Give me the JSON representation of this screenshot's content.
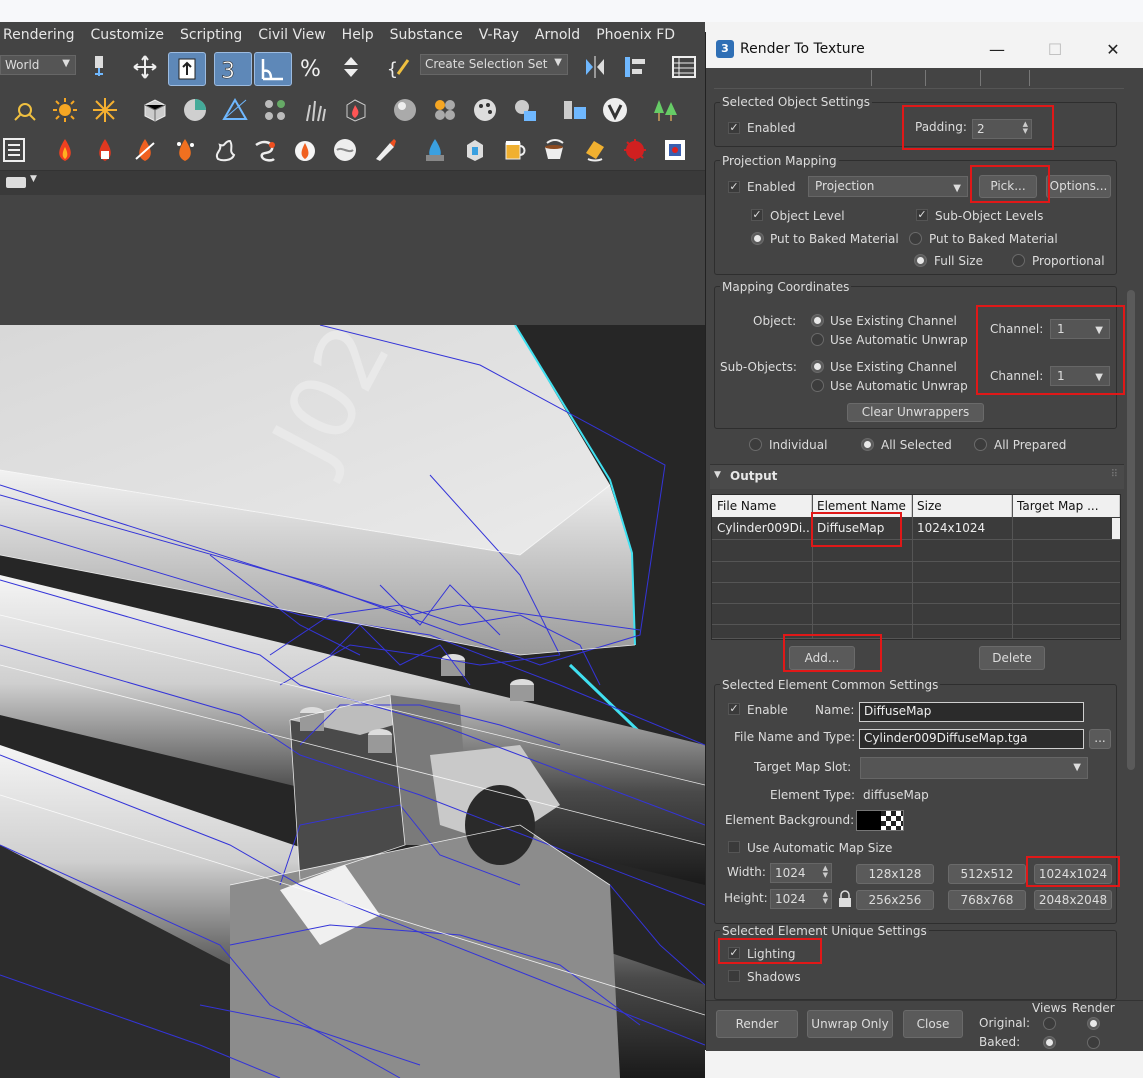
{
  "menu": [
    "Rendering",
    "Customize",
    "Scripting",
    "Civil View",
    "Help",
    "Substance",
    "V-Ray",
    "Arnold",
    "Phoenix FD"
  ],
  "toolbar": {
    "coord_system": "World",
    "selection_set_placeholder": "Create Selection Set"
  },
  "dialog": {
    "title": "Render To Texture",
    "selected_object_settings": {
      "title": "Selected Object Settings",
      "enabled_label": "Enabled",
      "padding_label": "Padding:",
      "padding_value": "2"
    },
    "projection_mapping": {
      "title": "Projection Mapping",
      "enabled_label": "Enabled",
      "projection_value": "Projection",
      "pick_label": "Pick...",
      "options_label": "Options...",
      "object_level": "Object Level",
      "sub_object_levels": "Sub-Object Levels",
      "put_to_baked_1": "Put to Baked Material",
      "put_to_baked_2": "Put to Baked Material",
      "full_size": "Full Size",
      "proportional": "Proportional"
    },
    "mapping_coordinates": {
      "title": "Mapping Coordinates",
      "object_label": "Object:",
      "sub_objects_label": "Sub-Objects:",
      "use_existing_1": "Use Existing Channel",
      "use_auto_1": "Use Automatic Unwrap",
      "use_existing_2": "Use Existing Channel",
      "use_auto_2": "Use Automatic Unwrap",
      "channel_label_1": "Channel:",
      "channel_value_1": "1",
      "channel_label_2": "Channel:",
      "channel_value_2": "1",
      "clear_unwrappers": "Clear Unwrappers"
    },
    "selection_mode": {
      "individual": "Individual",
      "all_selected": "All Selected",
      "all_prepared": "All Prepared"
    },
    "output": {
      "title": "Output",
      "columns": [
        "File Name",
        "Element Name",
        "Size",
        "Target Map ..."
      ],
      "row": {
        "file_name": "Cylinder009Di...",
        "element_name": "DiffuseMap",
        "size": "1024x1024",
        "target": ""
      },
      "add_label": "Add...",
      "delete_label": "Delete"
    },
    "common_settings": {
      "title": "Selected Element Common Settings",
      "enable_label": "Enable",
      "name_label": "Name:",
      "name_value": "DiffuseMap",
      "file_type_label": "File Name and Type:",
      "file_type_value": "Cylinder009DiffuseMap.tga",
      "browse_label": "...",
      "target_slot_label": "Target Map Slot:",
      "element_type_label": "Element Type:",
      "element_type_value": "diffuseMap",
      "background_label": "Element Background:",
      "auto_map_size_label": "Use Automatic Map Size",
      "width_label": "Width:",
      "width_value": "1024",
      "height_label": "Height:",
      "height_value": "1024",
      "sizes": [
        "128x128",
        "512x512",
        "1024x1024",
        "256x256",
        "768x768",
        "2048x2048"
      ]
    },
    "unique_settings": {
      "title": "Selected Element Unique Settings",
      "lighting_label": "Lighting",
      "shadows_label": "Shadows"
    },
    "footer": {
      "render_label": "Render",
      "unwrap_only_label": "Unwrap Only",
      "close_label": "Close",
      "views_label": "Views",
      "render_col_label": "Render",
      "original_label": "Original:",
      "baked_label": "Baked:"
    }
  },
  "colors": {
    "highlight_box": "#e01818",
    "ui_dark": "#444444",
    "wireframe": "#3030d0"
  }
}
